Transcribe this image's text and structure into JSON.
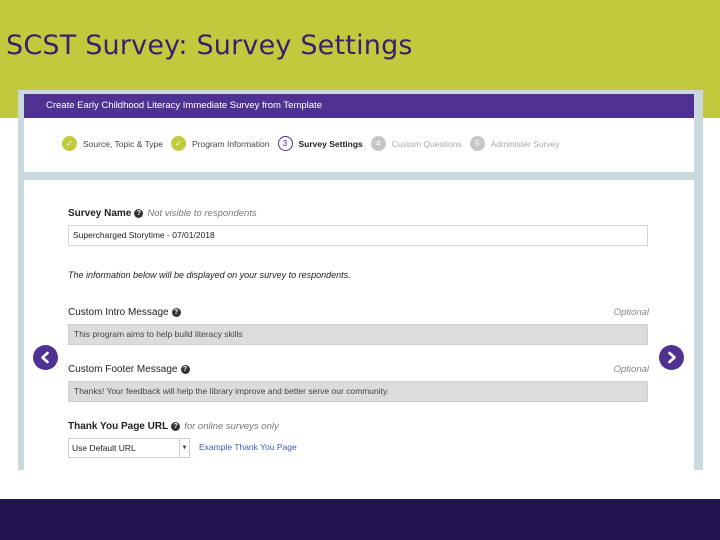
{
  "slide": {
    "title": "SCST Survey: Survey Settings"
  },
  "wizard": {
    "header": "Create Early Childhood Literacy Immediate Survey from Template",
    "steps": [
      {
        "marker": "✓",
        "label": "Source, Topic & Type",
        "state": "done"
      },
      {
        "marker": "✓",
        "label": "Program Information",
        "state": "done"
      },
      {
        "marker": "3",
        "label": "Survey Settings",
        "state": "current"
      },
      {
        "marker": "4",
        "label": "Custom Questions",
        "state": "todo"
      },
      {
        "marker": "5",
        "label": "Administer Survey",
        "state": "todo"
      }
    ]
  },
  "form": {
    "survey_name": {
      "label": "Survey Name",
      "hint": "Not visible to respondents",
      "value": "Supercharged Storytime - 07/01/2018"
    },
    "notice": "The information below will be displayed on your survey to respondents.",
    "intro": {
      "label": "Custom Intro Message",
      "optional": "Optional",
      "value": "This program aims to help build literacy skills"
    },
    "footer": {
      "label": "Custom Footer Message",
      "optional": "Optional",
      "value": "Thanks! Your feedback will help the library improve and better serve our community."
    },
    "thank_you": {
      "label": "Thank You Page URL",
      "hint": "for online surveys only",
      "selected": "Use Default URL",
      "link": "Example Thank You Page"
    },
    "help_glyph": "?"
  },
  "icons": {
    "prev": "chevron-left-icon",
    "next": "chevron-right-icon",
    "help": "question-circle-icon"
  },
  "colors": {
    "title_band": "#c1c93d",
    "title_text": "#3d1d6e",
    "footer_band": "#22154f",
    "wizard_header": "#4e3191",
    "step_done": "#c1c93d",
    "step_todo": "#c6c6c6",
    "screenshot_bg": "#c9d9de"
  }
}
